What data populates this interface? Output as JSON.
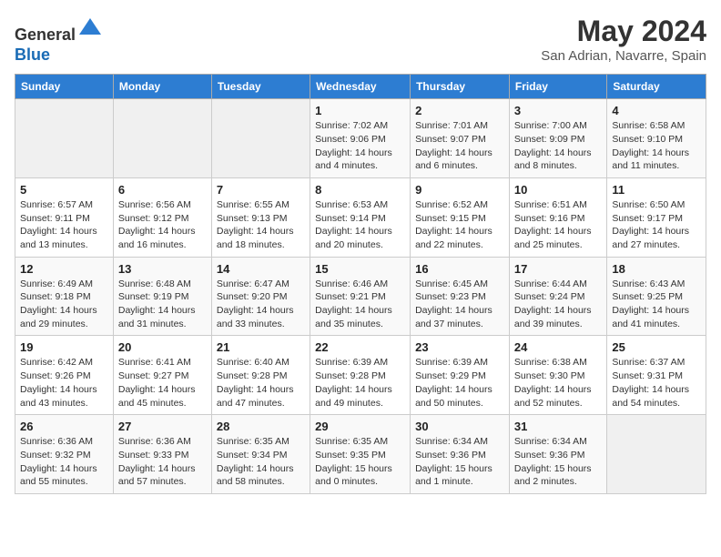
{
  "header": {
    "logo_line1": "General",
    "logo_line2": "Blue",
    "month_title": "May 2024",
    "location": "San Adrian, Navarre, Spain"
  },
  "weekdays": [
    "Sunday",
    "Monday",
    "Tuesday",
    "Wednesday",
    "Thursday",
    "Friday",
    "Saturday"
  ],
  "weeks": [
    [
      {
        "day": "",
        "empty": true
      },
      {
        "day": "",
        "empty": true
      },
      {
        "day": "",
        "empty": true
      },
      {
        "day": "1",
        "sunrise": "7:02 AM",
        "sunset": "9:06 PM",
        "daylight": "14 hours and 4 minutes."
      },
      {
        "day": "2",
        "sunrise": "7:01 AM",
        "sunset": "9:07 PM",
        "daylight": "14 hours and 6 minutes."
      },
      {
        "day": "3",
        "sunrise": "7:00 AM",
        "sunset": "9:09 PM",
        "daylight": "14 hours and 8 minutes."
      },
      {
        "day": "4",
        "sunrise": "6:58 AM",
        "sunset": "9:10 PM",
        "daylight": "14 hours and 11 minutes."
      }
    ],
    [
      {
        "day": "5",
        "sunrise": "6:57 AM",
        "sunset": "9:11 PM",
        "daylight": "14 hours and 13 minutes."
      },
      {
        "day": "6",
        "sunrise": "6:56 AM",
        "sunset": "9:12 PM",
        "daylight": "14 hours and 16 minutes."
      },
      {
        "day": "7",
        "sunrise": "6:55 AM",
        "sunset": "9:13 PM",
        "daylight": "14 hours and 18 minutes."
      },
      {
        "day": "8",
        "sunrise": "6:53 AM",
        "sunset": "9:14 PM",
        "daylight": "14 hours and 20 minutes."
      },
      {
        "day": "9",
        "sunrise": "6:52 AM",
        "sunset": "9:15 PM",
        "daylight": "14 hours and 22 minutes."
      },
      {
        "day": "10",
        "sunrise": "6:51 AM",
        "sunset": "9:16 PM",
        "daylight": "14 hours and 25 minutes."
      },
      {
        "day": "11",
        "sunrise": "6:50 AM",
        "sunset": "9:17 PM",
        "daylight": "14 hours and 27 minutes."
      }
    ],
    [
      {
        "day": "12",
        "sunrise": "6:49 AM",
        "sunset": "9:18 PM",
        "daylight": "14 hours and 29 minutes."
      },
      {
        "day": "13",
        "sunrise": "6:48 AM",
        "sunset": "9:19 PM",
        "daylight": "14 hours and 31 minutes."
      },
      {
        "day": "14",
        "sunrise": "6:47 AM",
        "sunset": "9:20 PM",
        "daylight": "14 hours and 33 minutes."
      },
      {
        "day": "15",
        "sunrise": "6:46 AM",
        "sunset": "9:21 PM",
        "daylight": "14 hours and 35 minutes."
      },
      {
        "day": "16",
        "sunrise": "6:45 AM",
        "sunset": "9:23 PM",
        "daylight": "14 hours and 37 minutes."
      },
      {
        "day": "17",
        "sunrise": "6:44 AM",
        "sunset": "9:24 PM",
        "daylight": "14 hours and 39 minutes."
      },
      {
        "day": "18",
        "sunrise": "6:43 AM",
        "sunset": "9:25 PM",
        "daylight": "14 hours and 41 minutes."
      }
    ],
    [
      {
        "day": "19",
        "sunrise": "6:42 AM",
        "sunset": "9:26 PM",
        "daylight": "14 hours and 43 minutes."
      },
      {
        "day": "20",
        "sunrise": "6:41 AM",
        "sunset": "9:27 PM",
        "daylight": "14 hours and 45 minutes."
      },
      {
        "day": "21",
        "sunrise": "6:40 AM",
        "sunset": "9:28 PM",
        "daylight": "14 hours and 47 minutes."
      },
      {
        "day": "22",
        "sunrise": "6:39 AM",
        "sunset": "9:28 PM",
        "daylight": "14 hours and 49 minutes."
      },
      {
        "day": "23",
        "sunrise": "6:39 AM",
        "sunset": "9:29 PM",
        "daylight": "14 hours and 50 minutes."
      },
      {
        "day": "24",
        "sunrise": "6:38 AM",
        "sunset": "9:30 PM",
        "daylight": "14 hours and 52 minutes."
      },
      {
        "day": "25",
        "sunrise": "6:37 AM",
        "sunset": "9:31 PM",
        "daylight": "14 hours and 54 minutes."
      }
    ],
    [
      {
        "day": "26",
        "sunrise": "6:36 AM",
        "sunset": "9:32 PM",
        "daylight": "14 hours and 55 minutes."
      },
      {
        "day": "27",
        "sunrise": "6:36 AM",
        "sunset": "9:33 PM",
        "daylight": "14 hours and 57 minutes."
      },
      {
        "day": "28",
        "sunrise": "6:35 AM",
        "sunset": "9:34 PM",
        "daylight": "14 hours and 58 minutes."
      },
      {
        "day": "29",
        "sunrise": "6:35 AM",
        "sunset": "9:35 PM",
        "daylight": "15 hours and 0 minutes."
      },
      {
        "day": "30",
        "sunrise": "6:34 AM",
        "sunset": "9:36 PM",
        "daylight": "15 hours and 1 minute."
      },
      {
        "day": "31",
        "sunrise": "6:34 AM",
        "sunset": "9:36 PM",
        "daylight": "15 hours and 2 minutes."
      },
      {
        "day": "",
        "empty": true
      }
    ]
  ]
}
